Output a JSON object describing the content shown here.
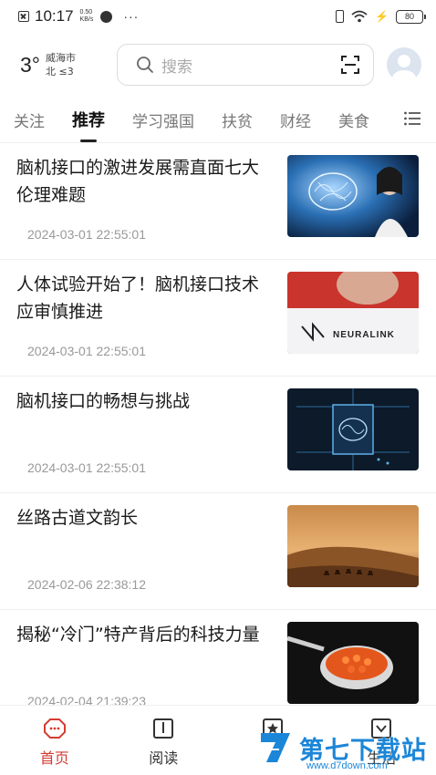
{
  "status_bar": {
    "time": "10:17",
    "net_speed_value": "0.50",
    "net_speed_unit": "KB/s",
    "more": "···",
    "battery": "80"
  },
  "weather": {
    "temperature": "3°",
    "city": "威海市",
    "wind": "北 ≤3"
  },
  "search": {
    "placeholder": "搜索"
  },
  "tabs": [
    {
      "label": "关注",
      "active": false
    },
    {
      "label": "推荐",
      "active": true
    },
    {
      "label": "学习强国",
      "active": false
    },
    {
      "label": "扶贫",
      "active": false
    },
    {
      "label": "财经",
      "active": false
    },
    {
      "label": "美食",
      "active": false
    }
  ],
  "news": [
    {
      "title": "脑机接口的激进发展需直面七大伦理难题",
      "time": "2024-03-01 22:55:01",
      "thumb": "brain-ai-woman"
    },
    {
      "title": "人体试验开始了！脑机接口技术应审慎推进",
      "time": "2024-03-01 22:55:01",
      "thumb": "neuralink-man"
    },
    {
      "title": "脑机接口的畅想与挑战",
      "time": "2024-03-01 22:55:01",
      "thumb": "brain-chip"
    },
    {
      "title": "丝路古道文韵长",
      "time": "2024-02-06 22:38:12",
      "thumb": "desert-camels"
    },
    {
      "title": "揭秘“冷门”特产背后的科技力量",
      "time": "2024-02-04 21:39:23",
      "thumb": "caviar-spoon"
    }
  ],
  "thumb_text": {
    "neuralink": "NEURALINK"
  },
  "bottom_nav": [
    {
      "label": "首页",
      "icon": "home-icon",
      "active": true
    },
    {
      "label": "阅读",
      "icon": "book-icon",
      "active": false
    },
    {
      "label": "",
      "icon": "star-icon",
      "active": false
    },
    {
      "label": "生活",
      "icon": "life-icon",
      "active": false
    }
  ],
  "watermark": {
    "text": "第七下载站",
    "url": "www.d7down.com"
  },
  "colors": {
    "accent_red": "#d43c33",
    "watermark_blue": "#1b86d8"
  }
}
